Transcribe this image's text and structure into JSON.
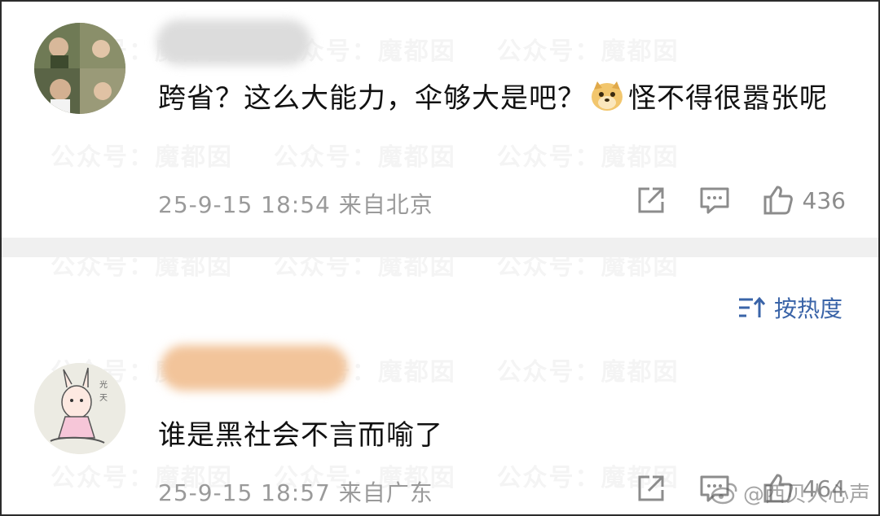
{
  "watermark": "公众号：魔都囡",
  "comments": [
    {
      "text_before_emoji": "跨省？这么大能力，伞够大是吧？",
      "emoji_name": "doge-emoji",
      "text_after_emoji": "怪不得很嚣张呢",
      "timestamp": "25-9-15 18:54",
      "location": "来自北京",
      "like_count": "436"
    },
    {
      "text_before_emoji": "谁是黑社会不言而喻了",
      "timestamp": "25-9-15 18:57",
      "location": "来自广东",
      "like_count": "464"
    }
  ],
  "sort_label": "按热度",
  "corner_watermark": "@西贝人心声",
  "icons": {
    "share": "share-icon",
    "comment": "comment-icon",
    "like": "thumbs-up-icon",
    "sort": "sort-icon"
  },
  "colors": {
    "link_blue": "#3a64a8",
    "meta_gray": "#9a9a9a"
  }
}
